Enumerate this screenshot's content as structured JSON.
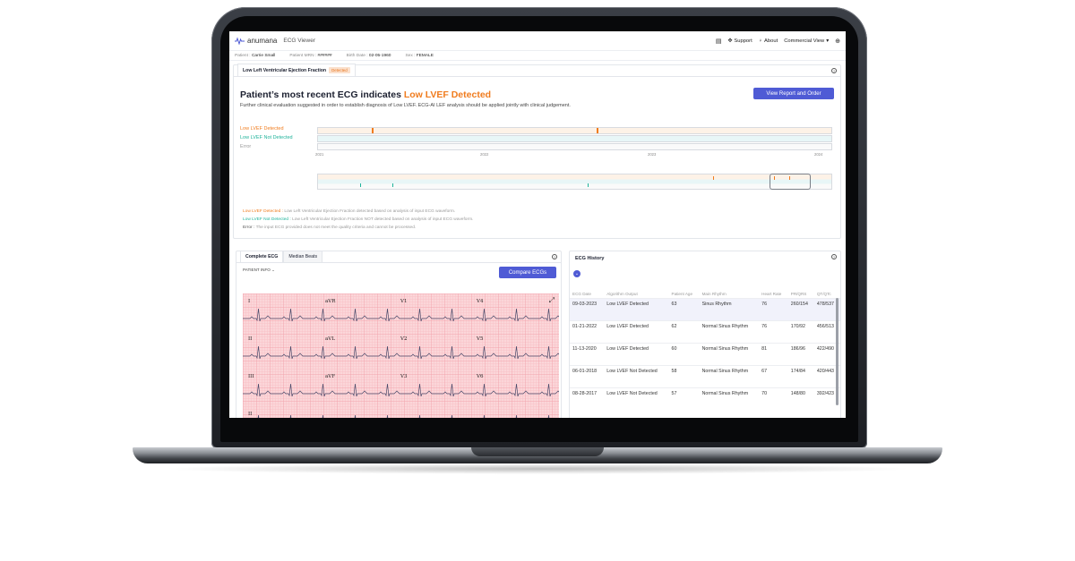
{
  "app": {
    "brand": "anumana",
    "title": "ECG Viewer",
    "support": "Support",
    "about": "About",
    "view_mode": "Commercial View"
  },
  "patient": {
    "name_label": "Patient :",
    "name": "Carrie Small",
    "mrn_label": "Patient MRN :",
    "mrn": "######",
    "dob_label": "Birth Date :",
    "dob": "02-05-1960",
    "sex_label": "Sex :",
    "sex": "FEMALE"
  },
  "lvef": {
    "tab_label": "Low Left Ventricular Ejection Fraction",
    "tab_badge": "Detected",
    "headline_prefix": "Patient’s most recent ECG indicates ",
    "headline_highlight": "Low LVEF Detected",
    "subline": "Further clinical evaluation suggested in order to establish diagnosis of Low LVEF. ECG-AI LEF analysis should be applied jointly with clinical judgement.",
    "report_button": "View Report and Order",
    "legend": [
      "Low LVEF Detected",
      "Low LVEF Not Detected",
      "Error"
    ],
    "years": [
      "2021",
      "2022",
      "2023",
      "2024"
    ],
    "desc": [
      {
        "term": "Low LVEF Detected :",
        "text": " Low Left Ventricular Ejection Fraction detected based on analysis of input ECG waveform."
      },
      {
        "term": "Low LVEF Not Detected :",
        "text": " Low Left Ventricular Ejection Fraction NOT detected based on analysis of input ECG waveform."
      },
      {
        "term": "Error :",
        "text": " The input ECG provided does not meet the quality criteria and cannot be processed."
      }
    ]
  },
  "ecg": {
    "tabs": [
      "Complete ECG",
      "Median Beats"
    ],
    "patient_info": "PATIENT INFO",
    "compare_button": "Compare ECGs",
    "leads": [
      "I",
      "aVR",
      "V1",
      "V4",
      "II",
      "aVL",
      "V2",
      "V5",
      "III",
      "aVF",
      "V3",
      "V6",
      "II"
    ]
  },
  "history": {
    "title": "ECG History",
    "columns": [
      "ECG Date",
      "Algorithm Output",
      "Patient Age",
      "Main Rhythm",
      "Heart Rate",
      "PR/QRS",
      "QT/QTc"
    ],
    "rows": [
      {
        "date": "09-03-2023",
        "output": "Low LVEF Detected",
        "age": "63",
        "rhythm": "Sinus Rhythm",
        "hr": "76",
        "prqrs": "260/154",
        "qt": "478/537"
      },
      {
        "date": "01-21-2022",
        "output": "Low LVEF Detected",
        "age": "62",
        "rhythm": "Normal Sinus Rhythm",
        "hr": "76",
        "prqrs": "170/92",
        "qt": "456/513"
      },
      {
        "date": "11-13-2020",
        "output": "Low LVEF Detected",
        "age": "60",
        "rhythm": "Normal Sinus Rhythm",
        "hr": "81",
        "prqrs": "186/96",
        "qt": "422/490"
      },
      {
        "date": "06-01-2018",
        "output": "Low LVEF Not Detected",
        "age": "58",
        "rhythm": "Normal Sinus Rhythm",
        "hr": "67",
        "prqrs": "174/84",
        "qt": "420/443"
      },
      {
        "date": "08-28-2017",
        "output": "Low LVEF Not Detected",
        "age": "57",
        "rhythm": "Normal Sinus Rhythm",
        "hr": "70",
        "prqrs": "148/80",
        "qt": "392/423"
      }
    ]
  },
  "colors": {
    "accent": "#4f5bd5",
    "detected": "#f07c1e",
    "not_detected": "#1fb39a"
  }
}
